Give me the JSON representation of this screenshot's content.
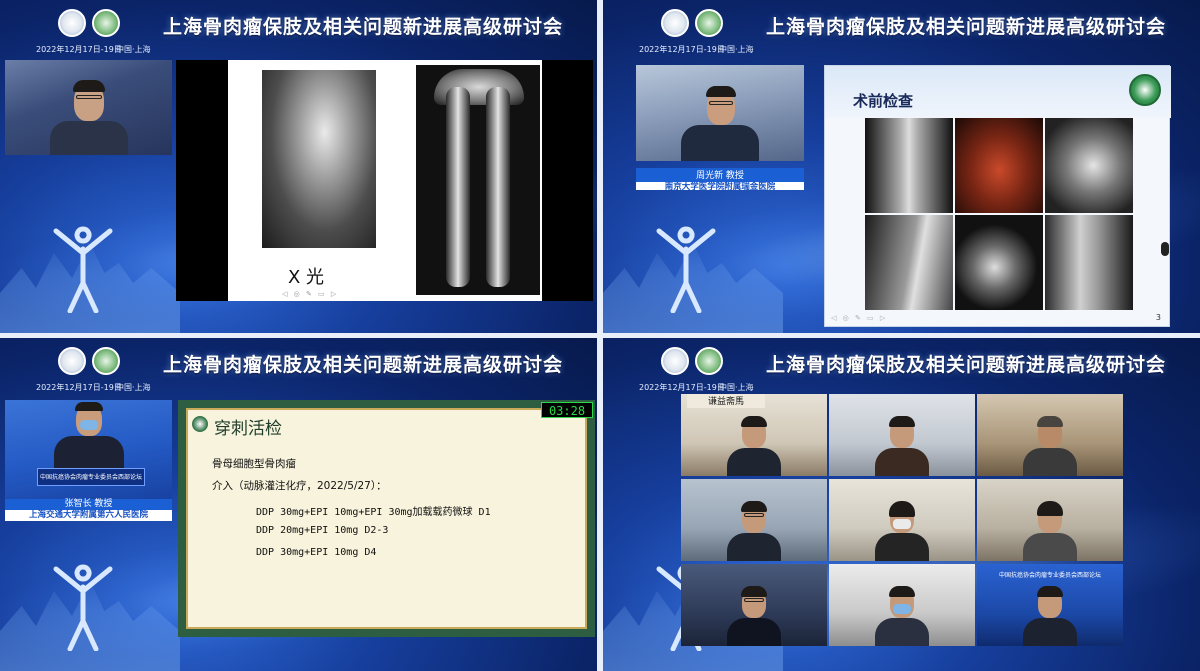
{
  "banner": {
    "title": "上海骨肉瘤保肢及相关问题新进展高级研讨会",
    "date": "2022年12月17日-19日",
    "location": "中国·上海"
  },
  "panel0": {
    "slide_label": "X 光"
  },
  "panel1": {
    "speaker_name": "周光新  教授",
    "speaker_affil": "南京大学医学院附属瑞金医院",
    "slide_title": "术前检查",
    "page_number": "3"
  },
  "panel2": {
    "speaker_name": "张智长  教授",
    "speaker_affil": "上海交通大学附属第六人民医院",
    "slide_title": "穿刺活检",
    "timer": "03:28",
    "lines": [
      "骨母细胞型骨肉瘤",
      "介入（动脉灌注化疗，2022/5/27）：",
      "DDP 30mg+EPI 10mg+EPI 30mg加载载药微球 D1",
      "DDP 20mg+EPI 10mg D2-3",
      "DDP 30mg+EPI 10mg D4"
    ]
  },
  "panel3": {
    "sign_text": "谦益斋馬",
    "banner_text": "中国抗癌协会肉瘤专业委员会西部论坛"
  },
  "colors": {
    "bg_blue": "#0b2468",
    "accent_blue": "#1b5fd4",
    "slide_border_green": "#2d5e41",
    "timer_green": "#2bd94a"
  }
}
